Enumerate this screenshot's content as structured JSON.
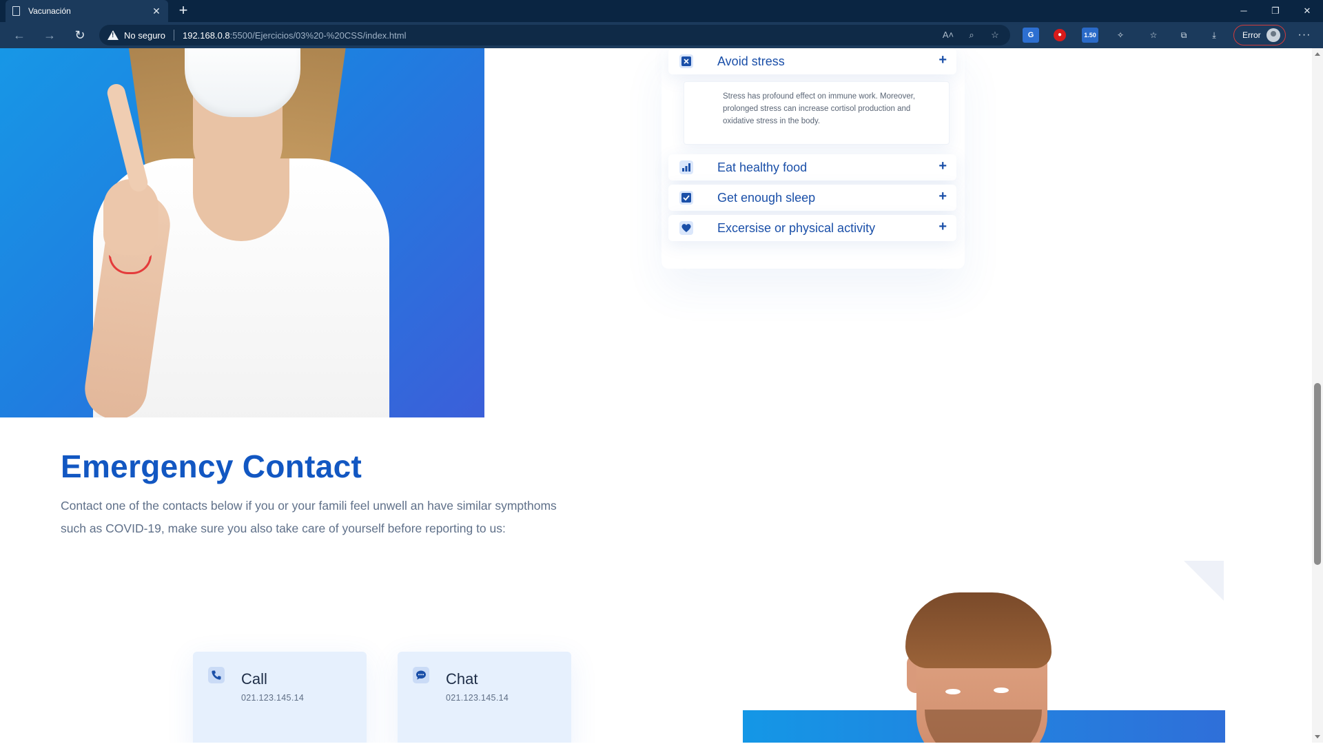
{
  "browser": {
    "tab_title": "Vacunación",
    "security_label": "No seguro",
    "url_host": "192.168.0.8",
    "url_rest": ":5500/Ejercicios/03%20-%20CSS/index.html",
    "profile_label": "Error",
    "extension_badge": "1.50"
  },
  "accordion": {
    "items": [
      {
        "label": "Avoid stress",
        "icon": "x-square-icon",
        "expanded": true,
        "body": "Stress has profound effect on immune work. Moreover, prolonged stress can increase cortisol production and oxidative stress in the body."
      },
      {
        "label": "Eat healthy food",
        "icon": "bar-chart-icon",
        "expanded": false
      },
      {
        "label": "Get enough sleep",
        "icon": "checkbox-icon",
        "expanded": false
      },
      {
        "label": "Excersise or physical activity",
        "icon": "heart-icon",
        "expanded": false
      }
    ],
    "toggle_symbol": "+"
  },
  "emergency": {
    "title": "Emergency Contact",
    "description": "Contact one of the contacts below if you or your famili feel unwell an have similar sympthoms such as COVID-19, make sure you also take care of yourself before reporting to us:"
  },
  "contacts": [
    {
      "title": "Call",
      "number": "021.123.145.14",
      "icon": "phone-icon"
    },
    {
      "title": "Chat",
      "number": "021.123.145.14",
      "icon": "chat-bubble-icon"
    }
  ],
  "colors": {
    "accent_blue": "#1257c2",
    "link_blue": "#1a4fa8",
    "card_bg": "#e6f0fd",
    "hero_gradient_start": "#1797e6",
    "hero_gradient_end": "#3b5fd9"
  }
}
